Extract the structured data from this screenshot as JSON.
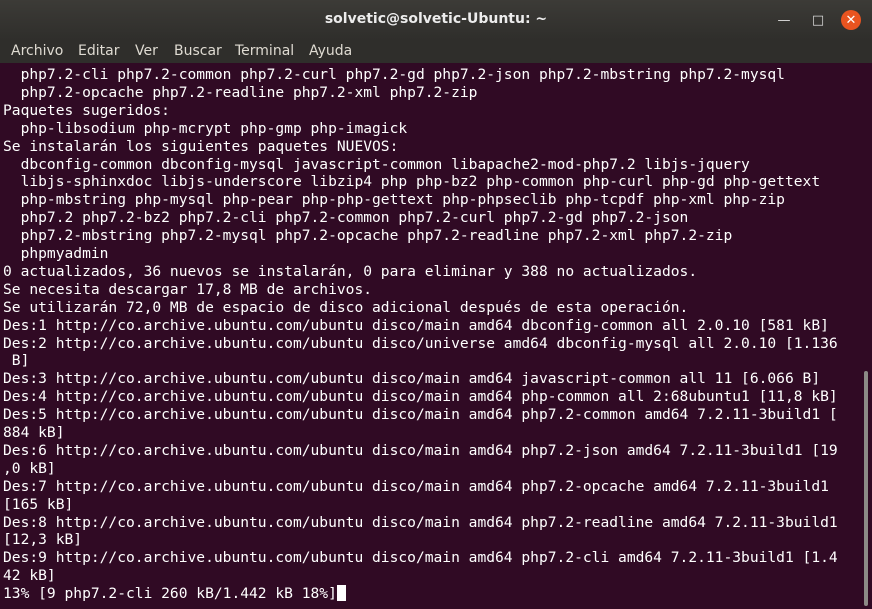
{
  "window": {
    "title": "solvetic@solvetic-Ubuntu: ~",
    "minimize_glyph": "—",
    "maximize_glyph": "□",
    "close_glyph": "✕"
  },
  "menu": [
    "Archivo",
    "Editar",
    "Ver",
    "Buscar",
    "Terminal",
    "Ayuda"
  ],
  "terminal_lines": [
    "  php7.2-cli php7.2-common php7.2-curl php7.2-gd php7.2-json php7.2-mbstring php7.2-mysql",
    "  php7.2-opcache php7.2-readline php7.2-xml php7.2-zip",
    "Paquetes sugeridos:",
    "  php-libsodium php-mcrypt php-gmp php-imagick",
    "Se instalarán los siguientes paquetes NUEVOS:",
    "  dbconfig-common dbconfig-mysql javascript-common libapache2-mod-php7.2 libjs-jquery",
    "  libjs-sphinxdoc libjs-underscore libzip4 php php-bz2 php-common php-curl php-gd php-gettext",
    "  php-mbstring php-mysql php-pear php-php-gettext php-phpseclib php-tcpdf php-xml php-zip",
    "  php7.2 php7.2-bz2 php7.2-cli php7.2-common php7.2-curl php7.2-gd php7.2-json",
    "  php7.2-mbstring php7.2-mysql php7.2-opcache php7.2-readline php7.2-xml php7.2-zip",
    "  phpmyadmin",
    "0 actualizados, 36 nuevos se instalarán, 0 para eliminar y 388 no actualizados.",
    "Se necesita descargar 17,8 MB de archivos.",
    "Se utilizarán 72,0 MB de espacio de disco adicional después de esta operación.",
    "Des:1 http://co.archive.ubuntu.com/ubuntu disco/main amd64 dbconfig-common all 2.0.10 [581 kB]",
    "Des:2 http://co.archive.ubuntu.com/ubuntu disco/universe amd64 dbconfig-mysql all 2.0.10 [1.136",
    " B]",
    "Des:3 http://co.archive.ubuntu.com/ubuntu disco/main amd64 javascript-common all 11 [6.066 B]",
    "Des:4 http://co.archive.ubuntu.com/ubuntu disco/main amd64 php-common all 2:68ubuntu1 [11,8 kB]",
    "Des:5 http://co.archive.ubuntu.com/ubuntu disco/main amd64 php7.2-common amd64 7.2.11-3build1 [",
    "884 kB]",
    "Des:6 http://co.archive.ubuntu.com/ubuntu disco/main amd64 php7.2-json amd64 7.2.11-3build1 [19",
    ",0 kB]",
    "Des:7 http://co.archive.ubuntu.com/ubuntu disco/main amd64 php7.2-opcache amd64 7.2.11-3build1",
    "[165 kB]",
    "Des:8 http://co.archive.ubuntu.com/ubuntu disco/main amd64 php7.2-readline amd64 7.2.11-3build1",
    "[12,3 kB]",
    "Des:9 http://co.archive.ubuntu.com/ubuntu disco/main amd64 php7.2-cli amd64 7.2.11-3build1 [1.4",
    "42 kB]",
    "13% [9 php7.2-cli 260 kB/1.442 kB 18%]"
  ]
}
